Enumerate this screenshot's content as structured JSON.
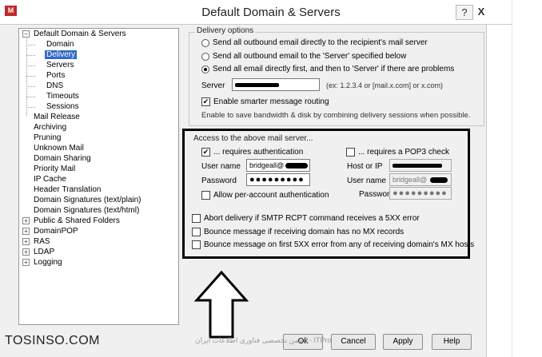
{
  "window": {
    "title": "Default Domain & Servers",
    "help_glyph": "?",
    "close_glyph": "X",
    "app_icon_text": "M"
  },
  "tree": {
    "items": [
      {
        "label": "Default Domain & Servers",
        "expander": "−"
      },
      {
        "label": "Domain"
      },
      {
        "label": "Delivery",
        "selected": true
      },
      {
        "label": "Servers"
      },
      {
        "label": "Ports"
      },
      {
        "label": "DNS"
      },
      {
        "label": "Timeouts"
      },
      {
        "label": "Sessions"
      },
      {
        "label": "Mail Release"
      },
      {
        "label": "Archiving"
      },
      {
        "label": "Pruning"
      },
      {
        "label": "Unknown Mail"
      },
      {
        "label": "Domain Sharing"
      },
      {
        "label": "Priority Mail"
      },
      {
        "label": "IP Cache"
      },
      {
        "label": "Header Translation"
      },
      {
        "label": "Domain Signatures (text/plain)"
      },
      {
        "label": "Domain Signatures (text/html)"
      },
      {
        "label": "Public & Shared Folders",
        "expander": "+"
      },
      {
        "label": "DomainPOP",
        "expander": "+"
      },
      {
        "label": "RAS",
        "expander": "+"
      },
      {
        "label": "LDAP",
        "expander": "+"
      },
      {
        "label": "Logging",
        "expander": "+"
      }
    ]
  },
  "delivery": {
    "group_label": "Delivery options",
    "options": [
      {
        "label": "Send all outbound email directly to the recipient's mail server",
        "selected": false
      },
      {
        "label": "Send all outbound email to the 'Server' specified below",
        "selected": false
      },
      {
        "label": "Send all email directly first, and then to 'Server' if there are problems",
        "selected": true
      }
    ],
    "server_label": "Server",
    "server_hint": "(ex: 1.2.3.4 or [mail.x.com] or x.com)",
    "smart_routing_label": "Enable smarter message routing",
    "smart_routing_checked": true,
    "smart_routing_desc": "Enable to save bandwidth & disk by combining delivery sessions when possible."
  },
  "access": {
    "group_label": "Access to the above mail server...",
    "requires_auth_label": "... requires authentication",
    "requires_auth_checked": true,
    "username_label": "User name",
    "username_value": "bridgeall@",
    "password_label": "Password",
    "password_value": "●●●●●●●●●",
    "per_account_label": "Allow per-account authentication",
    "per_account_checked": false,
    "pop3_label": "... requires a POP3 check",
    "pop3_checked": false,
    "host_label": "Host or IP",
    "pop3_username_label": "User name",
    "pop3_username_value": "bridgeall@",
    "pop3_password_label": "Password",
    "pop3_password_value": "●●●●●●●●●"
  },
  "abort_options": [
    {
      "label": "Abort delivery if SMTP RCPT command receives a 5XX error",
      "checked": false
    },
    {
      "label": "Bounce message if receiving domain has no MX records",
      "checked": false
    },
    {
      "label": "Bounce message on first 5XX error from any of receiving domain's MX hosts",
      "checked": false
    }
  ],
  "buttons": {
    "ok": "Ok",
    "cancel": "Cancel",
    "apply": "Apply",
    "help": "Help"
  },
  "watermark": {
    "site": "TOSINSO.COM",
    "subtitle": "ITPro - انجمن تخصصی فناوری اطلاعات ایران"
  }
}
